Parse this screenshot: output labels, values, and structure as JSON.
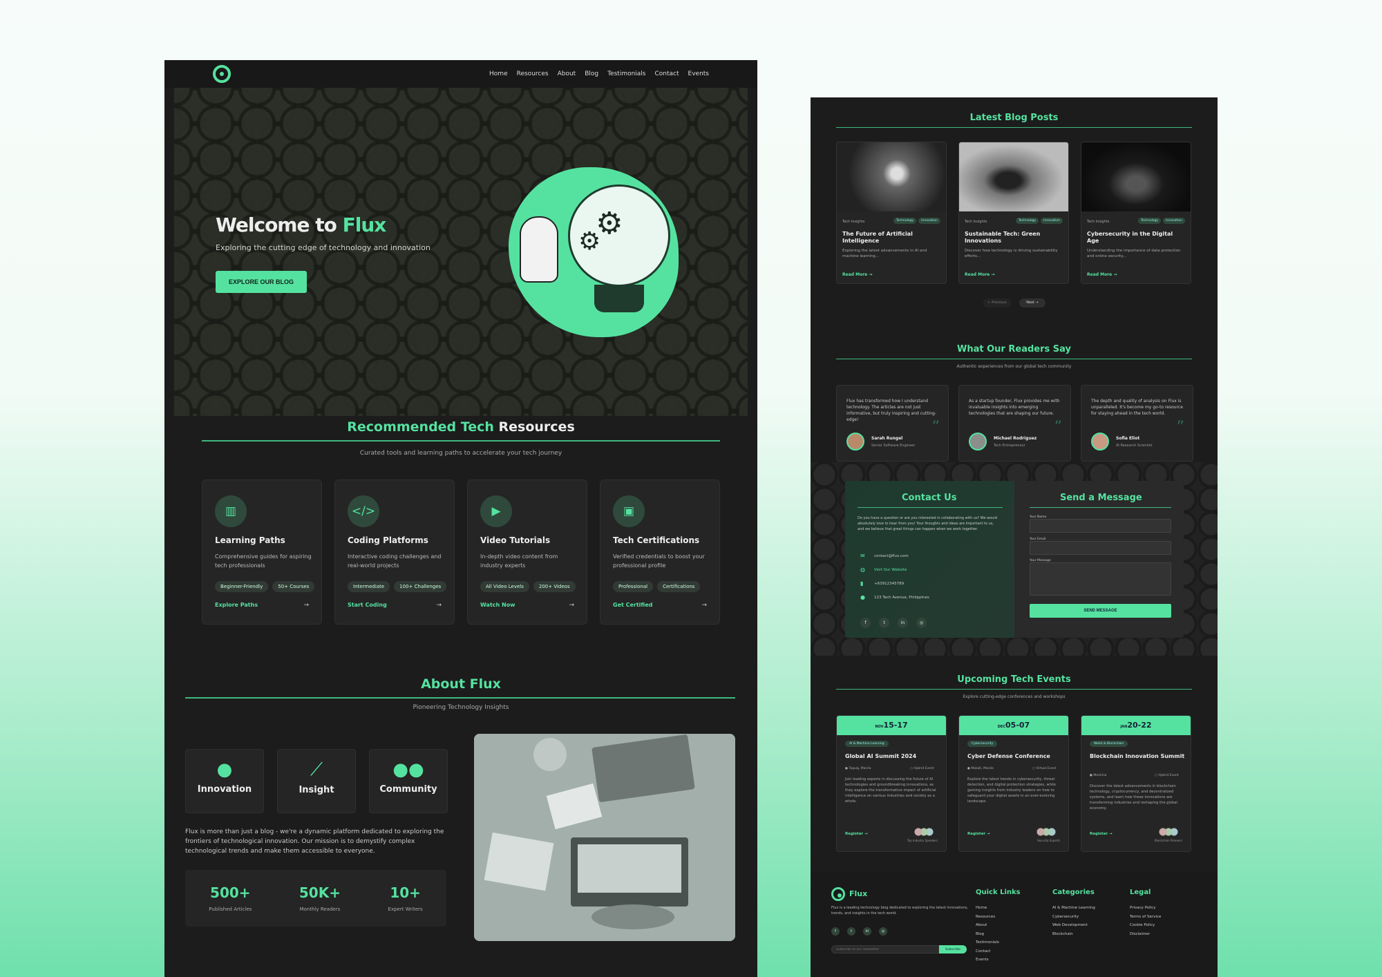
{
  "nav": {
    "links": [
      "Home",
      "Resources",
      "About",
      "Blog",
      "Testimonials",
      "Contact",
      "Events"
    ]
  },
  "hero": {
    "title_a": "Welcome to ",
    "title_b": "Flux",
    "subtitle": "Exploring the cutting edge of technology and innovation",
    "cta": "EXPLORE OUR BLOG"
  },
  "resources": {
    "title_a": "Recommended Tech ",
    "title_b": "Resources",
    "subtitle": "Curated tools and learning paths to accelerate your tech journey",
    "cards": [
      {
        "title": "Learning Paths",
        "desc": "Comprehensive guides for aspiring tech professionals",
        "chips": [
          "Beginner-Friendly",
          "50+ Courses"
        ],
        "link": "Explore Paths",
        "icon": "book-icon"
      },
      {
        "title": "Coding Platforms",
        "desc": "Interactive coding challenges and real-world projects",
        "chips": [
          "Intermediate",
          "100+ Challenges"
        ],
        "link": "Start Coding",
        "icon": "code-icon"
      },
      {
        "title": "Video Tutorials",
        "desc": "In-depth video content from industry experts",
        "chips": [
          "All Video Levels",
          "200+ Videos"
        ],
        "link": "Watch Now",
        "icon": "play-icon"
      },
      {
        "title": "Tech Certifications",
        "desc": "Verified credentials to boost your professional profile",
        "chips": [
          "Professional",
          "Certifications"
        ],
        "link": "Get Certified",
        "icon": "certificate-icon"
      }
    ]
  },
  "about": {
    "title_a": "About ",
    "title_b": "Flux",
    "subtitle": "Pioneering Technology Insights",
    "boxes": [
      "Innovation",
      "Insight",
      "Community"
    ],
    "text": "Flux is more than just a blog - we're a dynamic platform dedicated to exploring the frontiers of technological innovation. Our mission is to demystify complex technological trends and make them accessible to everyone.",
    "stats": [
      {
        "n": "500+",
        "l": "Published Articles"
      },
      {
        "n": "50K+",
        "l": "Monthly Readers"
      },
      {
        "n": "10+",
        "l": "Expert Writers"
      }
    ]
  },
  "blog": {
    "title": "Latest Blog Posts",
    "posts": [
      {
        "meta": "Tech Insights",
        "tags": [
          "Technology",
          "Innovation"
        ],
        "title": "The Future of Artificial Intelligence",
        "desc": "Exploring the latest advancements in AI and machine learning...",
        "link": "Read More →"
      },
      {
        "meta": "Tech Insights",
        "tags": [
          "Technology",
          "Innovation"
        ],
        "title": "Sustainable Tech: Green Innovations",
        "desc": "Discover how technology is driving sustainability efforts...",
        "link": "Read More →"
      },
      {
        "meta": "Tech Insights",
        "tags": [
          "Technology",
          "Innovation"
        ],
        "title": "Cybersecurity in the Digital Age",
        "desc": "Understanding the importance of data protection and online security...",
        "link": "Read More →"
      }
    ],
    "prev": "← Previous",
    "next": "Next →"
  },
  "testimonials": {
    "title": "What Our Readers Say",
    "subtitle": "Authentic experiences from our global tech community",
    "items": [
      {
        "quote": "Flux has transformed how I understand technology. The articles are not just informative, but truly inspiring and cutting-edge!",
        "name": "Sarah Rungel",
        "role": "Senior Software Engineer"
      },
      {
        "quote": "As a startup founder, Flux provides me with invaluable insights into emerging technologies that are shaping our future.",
        "name": "Michael Rodriguez",
        "role": "Tech Entrepreneur"
      },
      {
        "quote": "The depth and quality of analysis on Flux is unparalleled. It's become my go-to resource for staying ahead in the tech world.",
        "name": "Sofia Eliot",
        "role": "AI Research Scientist"
      }
    ]
  },
  "contact": {
    "title": "Contact Us",
    "desc": "Do you have a question or are you interested in collaborating with us? We would absolutely love to hear from you! Your thoughts and ideas are important to us, and we believe that great things can happen when we work together.",
    "email": "contact@flux.com",
    "website": "Visit Our Website",
    "phone": "+63912345789",
    "address": "123 Tech Avenue, Philippines",
    "form_title": "Send a Message",
    "name_label": "Your Name",
    "email_label": "Your Email",
    "message_label": "Your Message",
    "send": "SEND MESSAGE"
  },
  "events": {
    "title": "Upcoming Tech Events",
    "subtitle": "Explore cutting-edge conferences and workshops",
    "items": [
      {
        "month": "NOV",
        "days": "15-17",
        "cat": "AI & Machine Learning",
        "title": "Global AI Summit 2024",
        "loc": "Taguig, Manila",
        "mode": "Hybrid Event",
        "desc": "Join leading experts in discussing the future of AI technologies and groundbreaking innovations, as they explore the transformative impact of artificial intelligence on various industries and society as a whole.",
        "org": "Top Industry Speakers"
      },
      {
        "month": "DEC",
        "days": "05-07",
        "cat": "Cybersecurity",
        "title": "Cyber Defense Conference",
        "loc": "Makati, Manila",
        "mode": "Virtual Event",
        "desc": "Explore the latest trends in cybersecurity, threat detection, and digital protection strategies, while gaining insights from industry leaders on how to safeguard your digital assets in an ever-evolving landscape.",
        "org": "Security Experts"
      },
      {
        "month": "JAN",
        "days": "20-22",
        "cat": "Web3 & Blockchain",
        "title": "Blockchain Innovation Summit",
        "loc": "Marikina",
        "mode": "Hybrid Event",
        "desc": "Discover the latest advancements in blockchain technology, cryptocurrency, and decentralized systems, and learn how these innovations are transforming industries and reshaping the global economy.",
        "org": "Blockchain Pioneers"
      }
    ],
    "register": "Register →"
  },
  "footer": {
    "brand": "Flux",
    "desc": "Flux is a leading technology blog dedicated to exploring the latest innovations, trends, and insights in the tech world.",
    "subscribe_placeholder": "Subscribe to our newsletter",
    "subscribe": "Subscribe",
    "quick_title": "Quick Links",
    "quick": [
      "Home",
      "Resources",
      "About",
      "Blog",
      "Testimonials",
      "Contact",
      "Events"
    ],
    "cat_title": "Categories",
    "cats": [
      "AI & Machine Learning",
      "Cybersecurity",
      "Web Development",
      "Blockchain"
    ],
    "legal_title": "Legal",
    "legal": [
      "Privacy Policy",
      "Terms of Service",
      "Cookie Policy",
      "Disclaimer"
    ]
  },
  "colors": {
    "accent": "#55e2a0",
    "panel": "#1c1c1c",
    "card": "#252525"
  }
}
